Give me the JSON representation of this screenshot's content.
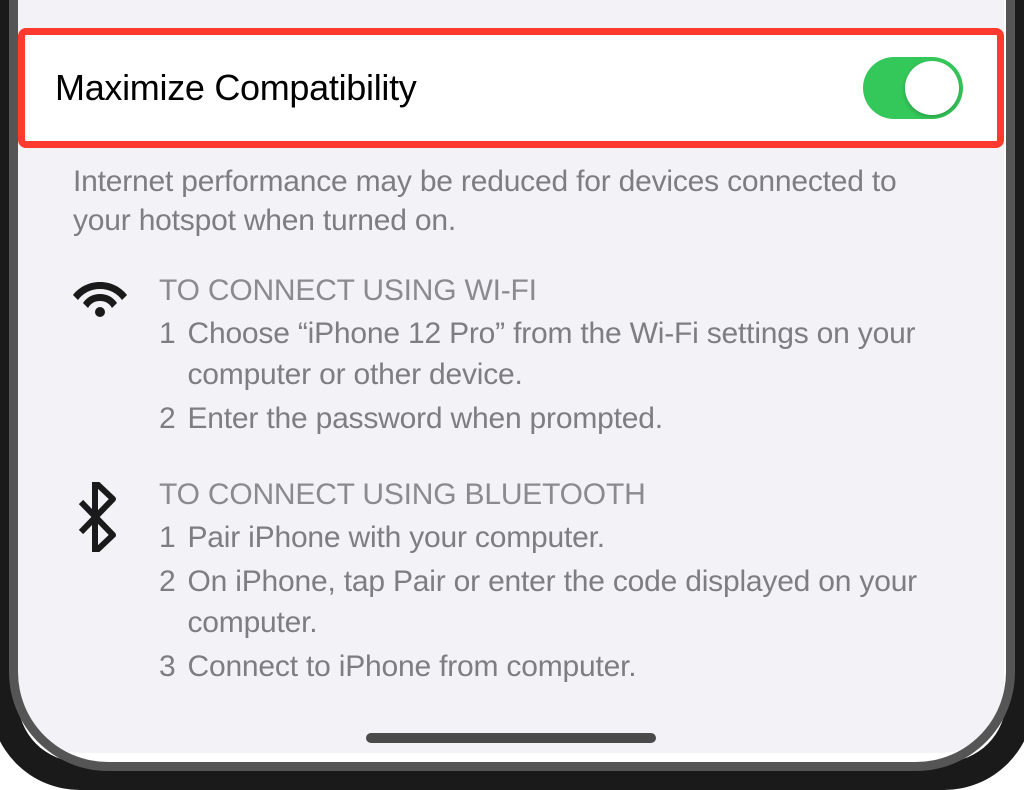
{
  "setting": {
    "label": "Maximize Compatibility",
    "toggle_on": true,
    "footer": "Internet performance may be reduced for devices connected to your hotspot when turned on."
  },
  "wifi": {
    "header": "TO CONNECT USING WI-FI",
    "steps": [
      {
        "num": "1",
        "text": "Choose “iPhone 12 Pro” from the Wi-Fi settings on your computer or other device."
      },
      {
        "num": "2",
        "text": "Enter the password when prompted."
      }
    ]
  },
  "bluetooth": {
    "header": "TO CONNECT USING BLUETOOTH",
    "steps": [
      {
        "num": "1",
        "text": "Pair iPhone with your computer."
      },
      {
        "num": "2",
        "text": "On iPhone, tap Pair or enter the code displayed on your computer."
      },
      {
        "num": "3",
        "text": "Connect to iPhone from computer."
      }
    ]
  }
}
